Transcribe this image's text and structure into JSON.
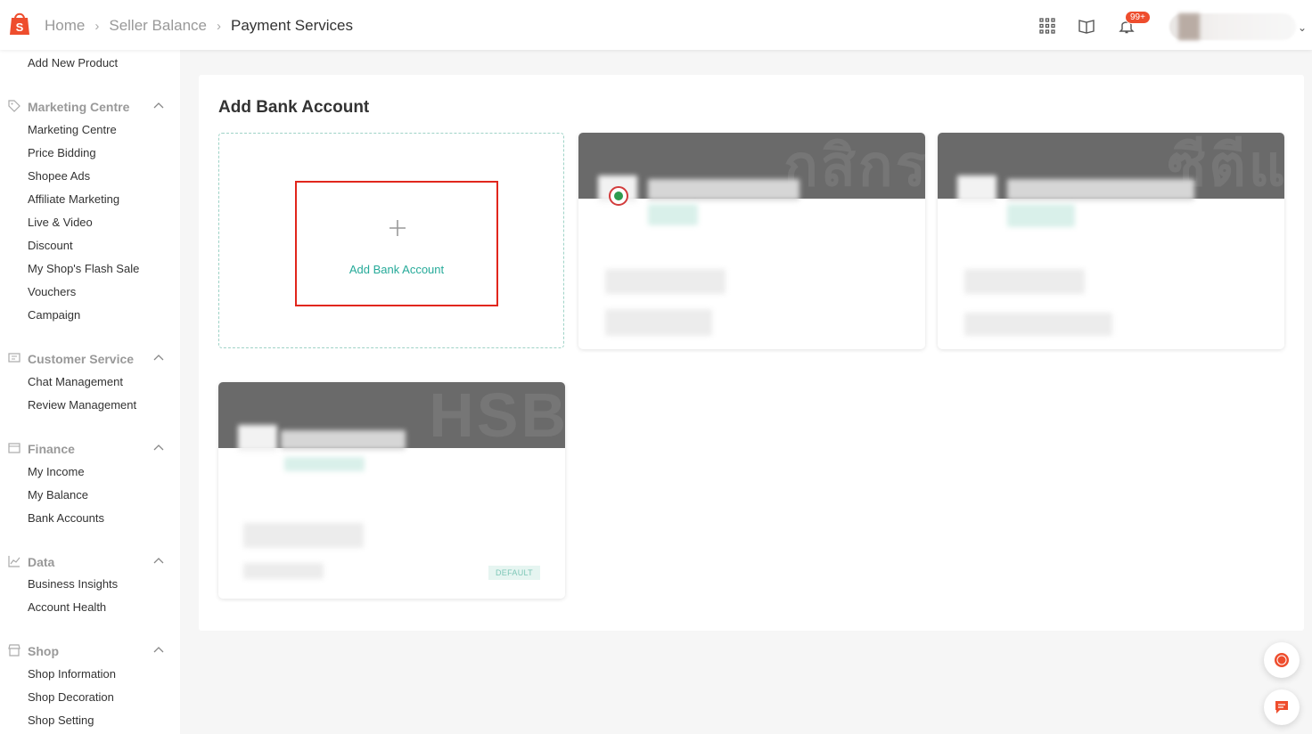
{
  "header": {
    "breadcrumbs": [
      "Home",
      "Seller Balance",
      "Payment Services"
    ],
    "notification_badge": "99+",
    "icons": [
      "shopee-logo-icon",
      "apps-grid-icon",
      "book-icon",
      "bell-icon",
      "chevron-down-icon"
    ]
  },
  "sidebar": {
    "top_item": "Add New Product",
    "sections": [
      {
        "title": "Marketing Centre",
        "icon": "tag-icon",
        "items": [
          "Marketing Centre",
          "Price Bidding",
          "Shopee Ads",
          "Affiliate Marketing",
          "Live & Video",
          "Discount",
          "My Shop's Flash Sale",
          "Vouchers",
          "Campaign"
        ]
      },
      {
        "title": "Customer Service",
        "icon": "chat-bubble-icon",
        "items": [
          "Chat Management",
          "Review Management"
        ]
      },
      {
        "title": "Finance",
        "icon": "wallet-icon",
        "items": [
          "My Income",
          "My Balance",
          "Bank Accounts"
        ]
      },
      {
        "title": "Data",
        "icon": "line-chart-icon",
        "items": [
          "Business Insights",
          "Account Health"
        ]
      },
      {
        "title": "Shop",
        "icon": "store-icon",
        "items": [
          "Shop Information",
          "Shop Decoration",
          "Shop Setting"
        ]
      }
    ]
  },
  "main": {
    "title": "Add Bank Account",
    "add_card_label": "Add Bank Account",
    "bank_cards": [
      {
        "watermark": "กสิกร",
        "is_default": false
      },
      {
        "watermark": "ซีตีแ",
        "is_default": false
      },
      {
        "watermark": "HSB",
        "is_default": true,
        "default_label": "DEFAULT"
      }
    ]
  },
  "colors": {
    "brand": "#ee4d2d",
    "accent": "#26aa99",
    "highlight_box": "#e1261c"
  }
}
